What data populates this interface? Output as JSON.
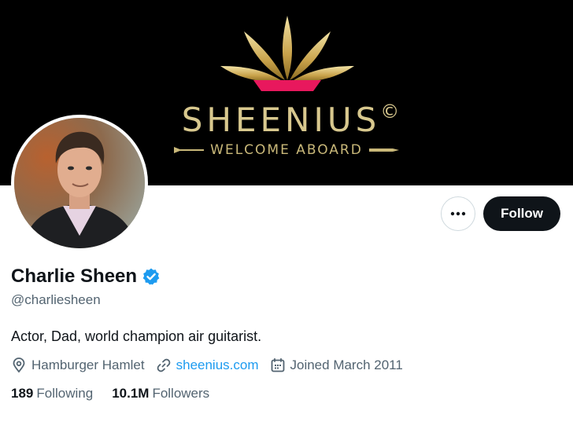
{
  "banner": {
    "brand_name": "SHEENIUS",
    "copyright_mark": "©",
    "tagline": "WELCOME ABOARD",
    "logo_icon": "gold-lotus-icon",
    "colors": {
      "background": "#000000",
      "gold": "#d8c88e",
      "accent_pink": "#e8185d"
    }
  },
  "avatar": {
    "alt": "Charlie Sheen"
  },
  "actions": {
    "more_icon": "more-dots-icon",
    "follow_label": "Follow"
  },
  "profile": {
    "display_name": "Charlie Sheen",
    "verified_icon": "verified-badge-icon",
    "handle": "@charliesheen",
    "bio": "Actor, Dad, world champion air guitarist.",
    "location_icon": "location-pin-icon",
    "location": "Hamburger Hamlet",
    "link_icon": "link-icon",
    "website": "sheenius.com",
    "calendar_icon": "calendar-icon",
    "joined": "Joined March 2011",
    "following_count": "189",
    "following_label": "Following",
    "followers_count": "10.1M",
    "followers_label": "Followers"
  },
  "colors": {
    "accent_blue": "#1d9bf0",
    "text_primary": "#0f1419",
    "text_secondary": "#536471",
    "button_dark": "#0f1419"
  }
}
